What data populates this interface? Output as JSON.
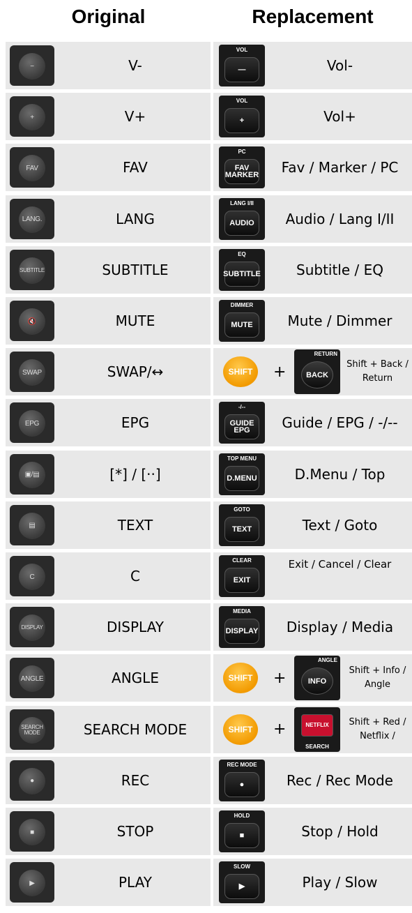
{
  "header": {
    "original": "Original",
    "replacement": "Replacement"
  },
  "rows": [
    {
      "orig_label": "V-",
      "orig_key": "−",
      "repl_key": "—",
      "repl_cap": "VOL",
      "repl_label": "Vol-"
    },
    {
      "orig_label": "V+",
      "orig_key": "+",
      "repl_key": "+",
      "repl_cap": "VOL",
      "repl_label": "Vol+"
    },
    {
      "orig_label": "FAV",
      "orig_key": "FAV",
      "repl_key": "FAV MARKER",
      "repl_cap": "PC",
      "repl_label": "Fav / Marker / PC"
    },
    {
      "orig_label": "LANG",
      "orig_key": "LANG.",
      "repl_key": "AUDIO",
      "repl_cap": "LANG I/II",
      "repl_label": "Audio / Lang I/II"
    },
    {
      "orig_label": "SUBTITLE",
      "orig_key": "SUBTITLE",
      "repl_key": "SUBTITLE",
      "repl_cap": "EQ",
      "repl_label": "Subtitle / EQ"
    },
    {
      "orig_label": "MUTE",
      "orig_key": "🔇",
      "repl_key": "MUTE",
      "repl_cap": "DIMMER",
      "repl_label": "Mute / Dimmer"
    },
    {
      "orig_label": "SWAP/↔",
      "orig_key": "SWAP",
      "shift": "SHIFT",
      "plus": "+",
      "repl_key": "BACK",
      "repl_cap": "RETURN",
      "repl_label": "Shift + Back / Return"
    },
    {
      "orig_label": "EPG",
      "orig_key": "EPG",
      "repl_key": "GUIDE EPG",
      "repl_cap": "-/--",
      "repl_label": "Guide / EPG / -/--"
    },
    {
      "orig_label": "[*] / [··]",
      "orig_key": "▣/▤",
      "repl_key": "D.MENU",
      "repl_cap": "TOP MENU",
      "repl_label": "D.Menu / Top"
    },
    {
      "orig_label": "TEXT",
      "orig_key": "▤",
      "repl_key": "TEXT",
      "repl_cap": "GOTO",
      "repl_label": "Text / Goto"
    },
    {
      "orig_label": "C",
      "orig_key": "C",
      "repl_key": "EXIT",
      "repl_cap": "CLEAR",
      "repl_label": "Exit / Cancel / Clear"
    },
    {
      "orig_label": "DISPLAY",
      "orig_key": "DISPLAY",
      "repl_key": "DISPLAY",
      "repl_cap": "MEDIA",
      "repl_label": "Display / Media"
    },
    {
      "orig_label": "ANGLE",
      "orig_key": "ANGLE",
      "shift": "SHIFT",
      "plus": "+",
      "repl_key": "INFO",
      "repl_cap": "ANGLE",
      "repl_label": "Shift + Info / Angle"
    },
    {
      "orig_label": "SEARCH MODE",
      "orig_key": "SEARCH MODE",
      "shift": "SHIFT",
      "plus": "+",
      "repl_key": "NETFLIX",
      "repl_cap": "",
      "repl_sub": "SEARCH",
      "repl_label": "Shift + Red / Netflix /"
    },
    {
      "orig_label": "REC",
      "orig_key": "●",
      "repl_key": "●",
      "repl_cap": "REC MODE",
      "repl_label": "Rec / Rec Mode"
    },
    {
      "orig_label": "STOP",
      "orig_key": "■",
      "repl_key": "■",
      "repl_cap": "HOLD",
      "repl_label": "Stop / Hold"
    },
    {
      "orig_label": "PLAY",
      "orig_key": "▶",
      "repl_key": "▶",
      "repl_cap": "SLOW",
      "repl_label": "Play / Slow"
    }
  ]
}
